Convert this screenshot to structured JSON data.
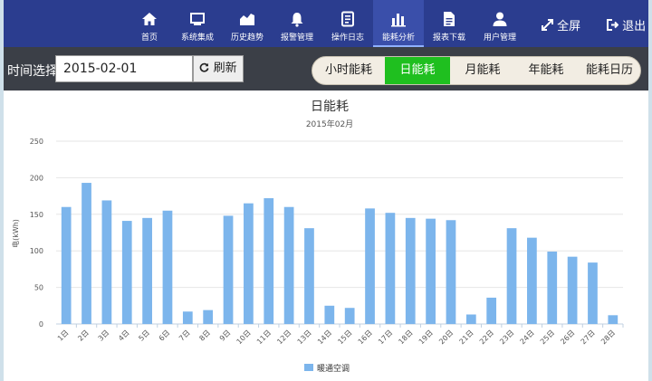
{
  "nav": {
    "items": [
      {
        "label": "首页",
        "icon": "home-icon"
      },
      {
        "label": "系统集成",
        "icon": "monitor-icon"
      },
      {
        "label": "历史趋势",
        "icon": "trend-chart-icon"
      },
      {
        "label": "报警管理",
        "icon": "bell-icon"
      },
      {
        "label": "操作日志",
        "icon": "log-book-icon"
      },
      {
        "label": "能耗分析",
        "icon": "bar-chart-icon",
        "active": true
      },
      {
        "label": "报表下载",
        "icon": "report-file-icon"
      },
      {
        "label": "用户管理",
        "icon": "user-icon"
      }
    ],
    "fullscreen": "全屏",
    "logout": "退出"
  },
  "toolbar": {
    "date_label": "时间选择:",
    "date_value": "2015-02-01",
    "refresh_label": "刷新",
    "tabs": [
      {
        "label": "小时能耗"
      },
      {
        "label": "日能耗",
        "active": true
      },
      {
        "label": "月能耗"
      },
      {
        "label": "年能耗"
      },
      {
        "label": "能耗日历"
      }
    ]
  },
  "colors": {
    "accent": "#2b3d8f",
    "active_tab": "#1fbf1f",
    "bar": "#7cb5ec"
  },
  "chart_data": {
    "type": "bar",
    "title": "日能耗",
    "subtitle": "2015年02月",
    "ylabel": "电(kWh)",
    "xlabel": "",
    "ylim": [
      0,
      250
    ],
    "yticks": [
      0,
      50,
      100,
      150,
      200,
      250
    ],
    "grid": true,
    "legend_position": "bottom-center",
    "categories": [
      "1日",
      "2日",
      "3日",
      "4日",
      "5日",
      "6日",
      "7日",
      "8日",
      "9日",
      "10日",
      "11日",
      "12日",
      "13日",
      "14日",
      "15日",
      "16日",
      "17日",
      "18日",
      "19日",
      "20日",
      "21日",
      "22日",
      "23日",
      "24日",
      "25日",
      "26日",
      "27日",
      "28日"
    ],
    "series": [
      {
        "name": "暖通空调",
        "values": [
          160,
          193,
          169,
          141,
          145,
          155,
          17,
          19,
          148,
          165,
          172,
          160,
          131,
          25,
          22,
          158,
          152,
          145,
          144,
          142,
          13,
          36,
          131,
          118,
          99,
          92,
          84,
          12
        ]
      }
    ]
  }
}
